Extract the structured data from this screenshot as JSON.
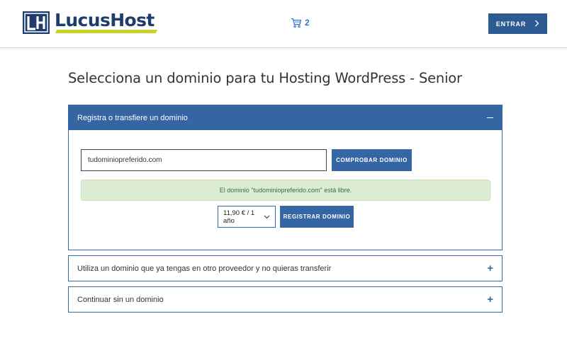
{
  "header": {
    "logo_text": "LucusHost",
    "logo_mark": "LH",
    "cart_icon": "cart-icon",
    "cart_count": "2",
    "enter_label": "ENTRAR",
    "enter_icon": "chevron-right-icon"
  },
  "page": {
    "title": "Selecciona un dominio para tu Hosting WordPress - Senior"
  },
  "panels": {
    "register": {
      "label": "Registra o transfiere un dominio",
      "toggle": "−",
      "domain_value": "tudominiopreferido.com",
      "check_label": "COMPROBAR DOMINIO",
      "availability_message": "El dominio \"tudominiopreferido.com\" está libre.",
      "price_selected": "11,90 € / 1 año",
      "register_label": "REGISTRAR DOMINIO"
    },
    "existing": {
      "label": "Utiliza un dominio que ya tengas en otro proveedor y no quieras transferir",
      "toggle": "+"
    },
    "none": {
      "label": "Continuar sin un dominio",
      "toggle": "+"
    }
  },
  "colors": {
    "brand_navy": "#1f3d6b",
    "accent_lime": "#c9d42a",
    "primary_blue": "#3565a3",
    "success_bg": "#dcedd4",
    "success_text": "#3d6b34"
  }
}
